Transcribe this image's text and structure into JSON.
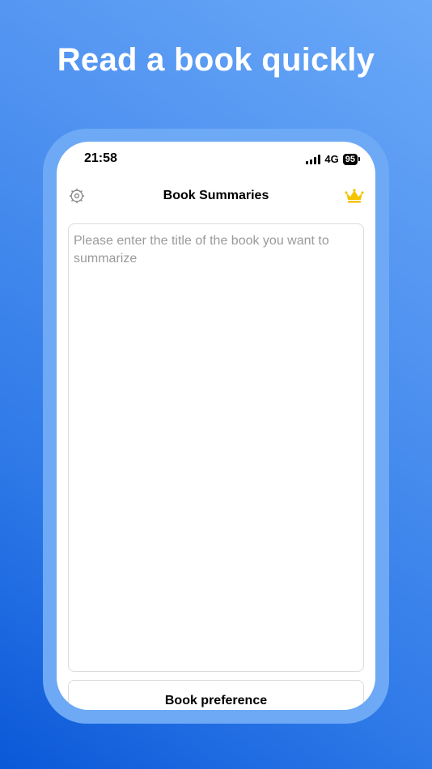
{
  "headline": "Read a book quickly",
  "status_bar": {
    "time": "21:58",
    "network": "4G",
    "battery": "95"
  },
  "nav": {
    "title": "Book Summaries",
    "left_icon": "gear-icon",
    "right_icon": "crown-icon"
  },
  "input": {
    "value": "",
    "placeholder": "Please enter the title of the book you want to summarize"
  },
  "preference_button": {
    "label": "Book preference"
  },
  "colors": {
    "background_top": "#6aa9f8",
    "background_bottom": "#0b58d8",
    "frame": "#6ea9f6",
    "crown": "#f5c400",
    "placeholder": "#9a9a9a"
  }
}
